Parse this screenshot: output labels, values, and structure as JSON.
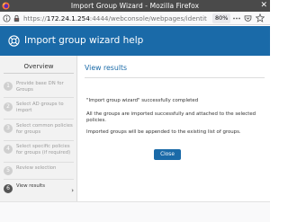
{
  "window": {
    "title": "Import Group Wizard - Mozilla Firefox",
    "close_glyph": "✕"
  },
  "urlbar": {
    "url_scheme": "https://",
    "url_host": "172.24.1.254",
    "url_path": ":4444/webconsole/webpages/identit",
    "zoom": "80%",
    "more_glyph": "•••"
  },
  "help": {
    "title": "Import group wizard help"
  },
  "overview": {
    "title": "Overview",
    "steps": [
      {
        "number": "1",
        "label": "Provide base DN for Groups",
        "active": false
      },
      {
        "number": "2",
        "label": "Select AD groups to import",
        "active": false
      },
      {
        "number": "3",
        "label": "Select common policies for groups",
        "active": false
      },
      {
        "number": "4",
        "label": "Select specific policies for groups (if required)",
        "active": false
      },
      {
        "number": "5",
        "label": "Review selection",
        "active": false
      },
      {
        "number": "6",
        "label": "View results",
        "active": true
      }
    ],
    "active_chevron": "›"
  },
  "content": {
    "heading": "View results",
    "paragraphs": [
      "\"Import group wizard\" successfully completed",
      "All the groups are imported successfully and attached to the selected policies.",
      "Imported groups will be appended to the existing list of groups."
    ],
    "close_label": "Close"
  },
  "icons": {
    "firefox": "firefox-icon",
    "info": "info-icon",
    "lock": "lock-icon",
    "more": "more-icon",
    "pocket": "pocket-icon",
    "star": "star-icon",
    "help": "help-icon"
  },
  "colors": {
    "accent": "#1a6aa8",
    "titlebar": "#4a4a4a",
    "sidebar_bg": "#f2f2f2"
  }
}
